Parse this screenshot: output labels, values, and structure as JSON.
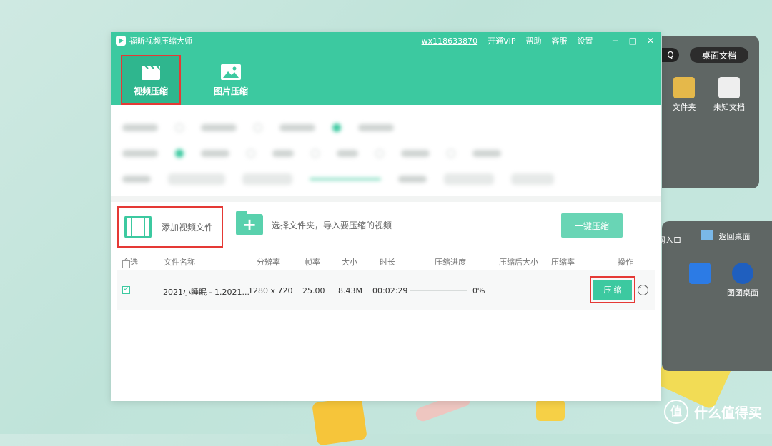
{
  "window": {
    "title": "福昕视频压缩大师",
    "user_id": "wx118633870",
    "menu": [
      "开通VIP",
      "帮助",
      "客服",
      "设置"
    ],
    "controls": [
      "−",
      "□",
      "✕"
    ]
  },
  "modes": [
    {
      "label": "视频压缩",
      "icon": "clapperboard-icon",
      "active": true
    },
    {
      "label": "图片压缩",
      "icon": "image-icon",
      "active": false
    }
  ],
  "add_file": {
    "label": "添加视频文件"
  },
  "add_folder": {
    "label": "选择文件夹，导入要压缩的视频",
    "glyph": "+"
  },
  "one_key_compress": "一键压缩",
  "table": {
    "select_all": "全选",
    "headers": {
      "name": "文件名称",
      "resolution": "分辨率",
      "fps": "帧率",
      "size": "大小",
      "duration": "时长",
      "progress": "压缩进度",
      "after_size": "压缩后大小",
      "ratio": "压缩率",
      "actions": "操作"
    },
    "rows": [
      {
        "checked": true,
        "name": "2021小睡眠 - 1.2021...",
        "resolution": "1280 x 720",
        "fps": "25.00",
        "size": "8.43M",
        "duration": "00:02:29",
        "progress": 0,
        "progress_text": "0%",
        "action": "压 缩",
        "more": "⋯"
      }
    ]
  },
  "desktop": {
    "search_glyph": "Q",
    "desktop_docs": "桌面文档",
    "icons_top": [
      "文件夹",
      "未知文档"
    ],
    "icons_bottom": [
      "返回桌面",
      "图图桌面"
    ],
    "partial_text": "网入口"
  },
  "watermark": {
    "logo_glyph": "值",
    "text": "什么值得买"
  },
  "colors": {
    "brand": "#3cc9a0",
    "highlight": "#e53935"
  }
}
